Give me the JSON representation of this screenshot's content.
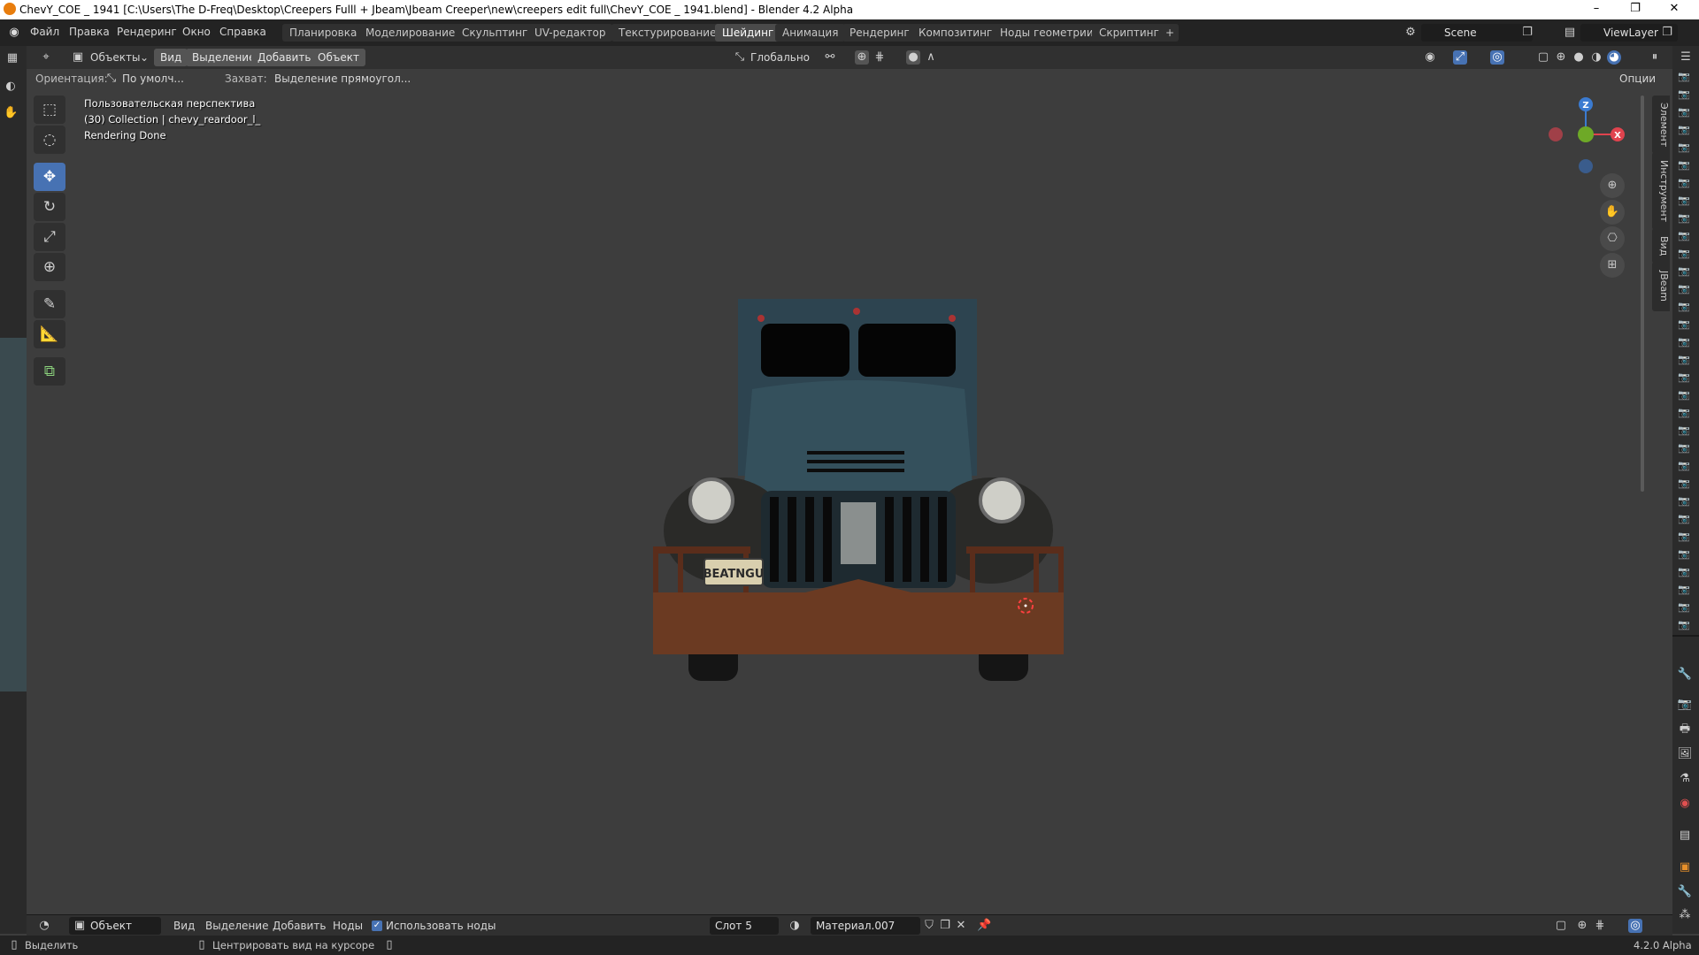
{
  "window": {
    "title": "ChevY_COE  _ 1941 [C:\\Users\\The D-Freq\\Desktop\\Creepers Fulll + Jbeam\\Jbeam Creeper\\new\\creepers edit full\\ChevY_COE  _ 1941.blend] - Blender 4.2 Alpha",
    "minimize": "–",
    "maximize": "❐",
    "close": "✕"
  },
  "menu": [
    "Файл",
    "Правка",
    "Рендеринг",
    "Окно",
    "Справка"
  ],
  "workspaces": [
    "Планировка",
    "Моделирование",
    "Скульптинг",
    "UV-редактор",
    "Текстурирование",
    "Шейдинг",
    "Анимация",
    "Рендеринг",
    "Композитинг",
    "Ноды геометрии",
    "Скриптинг"
  ],
  "active_workspace_index": 5,
  "add_workspace": "+",
  "scene": "Scene",
  "view_layer": "ViewLayer",
  "header": {
    "mode": "Объекты",
    "view": "Вид",
    "select": "Выделение",
    "add": "Добавить",
    "object": "Объект",
    "transform": "Глобально",
    "options": "Опции"
  },
  "tool_settings": {
    "orientation_label": "Ориентация:",
    "orientation_value": "По умолч...",
    "snap_label": "Захват:",
    "snap_value": "Выделение прямоугол..."
  },
  "viewport": {
    "perspective": "Пользовательская перспектива",
    "collection": "(30) Collection | chevy_reardoor_l_",
    "render_status": "Rendering Done",
    "plate_text": "BEATNGU",
    "gizmo": {
      "z": "Z",
      "x": "X"
    }
  },
  "n_panel_tabs": [
    "Элемент",
    "Инструмент",
    "Вид",
    "JBeam"
  ],
  "node_header": {
    "mode": "Объект",
    "view": "Вид",
    "select": "Выделение",
    "add": "Добавить",
    "nodes": "Ноды",
    "use_nodes": "Использовать ноды",
    "slot": "Слот 5",
    "material": "Материал.007"
  },
  "status": {
    "select": "Выделить",
    "center_view": "Центрировать вид на курсоре",
    "version": "4.2.0 Alpha"
  },
  "colors": {
    "accent": "#4772b3",
    "axis_x": "#e0434e",
    "axis_y": "#6ea927",
    "axis_z": "#3b7bd1"
  }
}
